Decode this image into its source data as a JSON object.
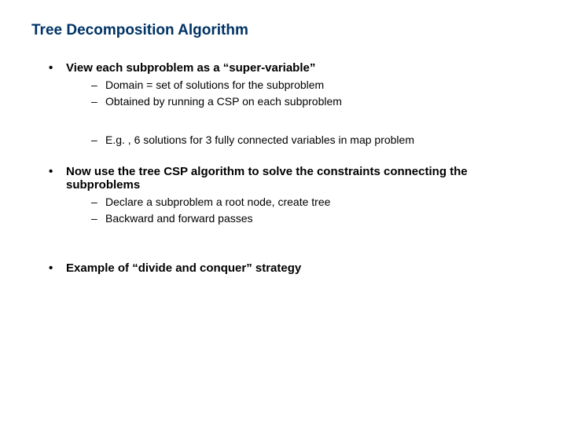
{
  "title": "Tree Decomposition Algorithm",
  "bullets": [
    {
      "text": "View each subproblem as a “super-variable”",
      "subs_a": [
        "Domain = set of solutions for the subproblem",
        "Obtained by running a CSP on each subproblem"
      ],
      "subs_b": [
        "E.g. , 6 solutions for 3 fully connected variables in map problem"
      ]
    },
    {
      "text": "Now use the tree CSP algorithm to solve the constraints connecting the subproblems",
      "subs_a": [
        "Declare a subproblem a root node, create tree",
        "Backward and forward passes"
      ]
    },
    {
      "text": "Example of “divide and conquer” strategy"
    }
  ]
}
